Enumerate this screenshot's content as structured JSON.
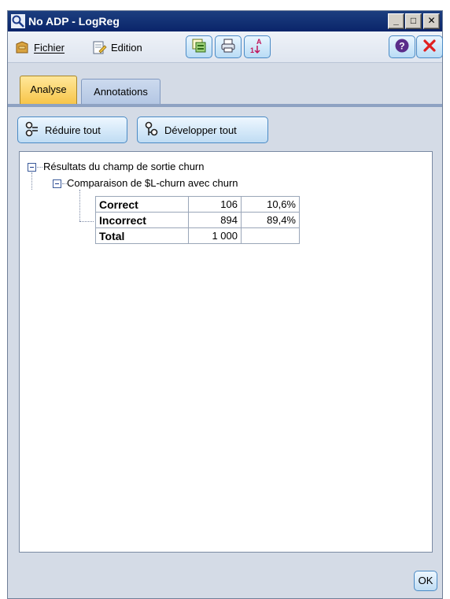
{
  "window": {
    "title": "No ADP - LogReg",
    "controls": {
      "minimize": "_",
      "maximize": "□",
      "close": "✕"
    }
  },
  "toolbar": {
    "menu_file": "Fichier",
    "menu_edit": "Edition",
    "buttons": [
      "copy-icon",
      "print-icon",
      "sort-icon"
    ],
    "help_icon": "help-icon",
    "close_icon": "close-icon"
  },
  "tabs": [
    {
      "label": "Analyse",
      "active": true
    },
    {
      "label": "Annotations",
      "active": false
    }
  ],
  "actions": {
    "collapse_all": "Réduire tout",
    "expand_all": "Développer tout"
  },
  "tree": {
    "root_label": "Résultats du champ de sortie churn",
    "child_label": "Comparaison de $L-churn avec churn",
    "table": [
      {
        "label": "Correct",
        "count": "106",
        "percent": "10,6%"
      },
      {
        "label": "Incorrect",
        "count": "894",
        "percent": "89,4%"
      },
      {
        "label": "Total",
        "count": "1 000",
        "percent": ""
      }
    ]
  },
  "footer": {
    "ok_label": "OK"
  },
  "colors": {
    "titlebar": "#0a246a",
    "active_tab": "#f7c447",
    "inactive_tab": "#b3c6e3",
    "button_border": "#4a8ac5",
    "close_red": "#e02020",
    "help_purple": "#5a2d8a"
  }
}
